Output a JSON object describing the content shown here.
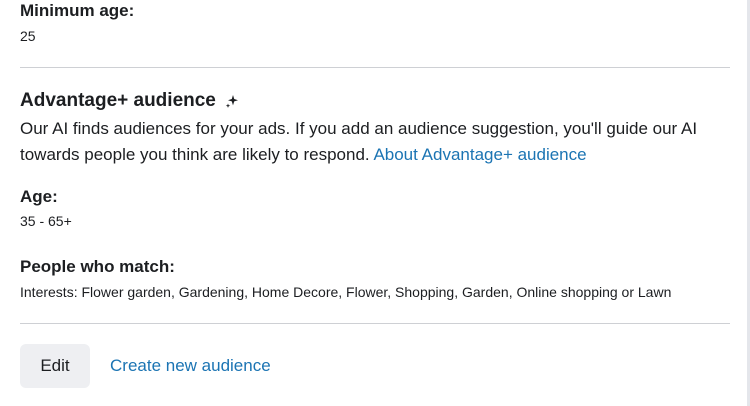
{
  "minimum_age": {
    "label": "Minimum age:",
    "value": "25"
  },
  "advantage_audience": {
    "title": "Advantage+ audience",
    "icon": "sparkle-icon",
    "description": "Our AI finds audiences for your ads. If you add an audience suggestion, you'll guide our AI towards people you think are likely to respond.",
    "link_label": "About Advantage+ audience"
  },
  "age": {
    "label": "Age:",
    "value": "35 - 65+"
  },
  "people_who_match": {
    "label": "People who match:",
    "value": "Interests: Flower garden, Gardening, Home Decore, Flower, Shopping, Garden, Online shopping or Lawn"
  },
  "actions": {
    "edit_label": "Edit",
    "create_label": "Create new audience"
  },
  "colors": {
    "link": "#1b74b3",
    "button_bg": "#eeeff2",
    "divider": "#ced0d4"
  }
}
